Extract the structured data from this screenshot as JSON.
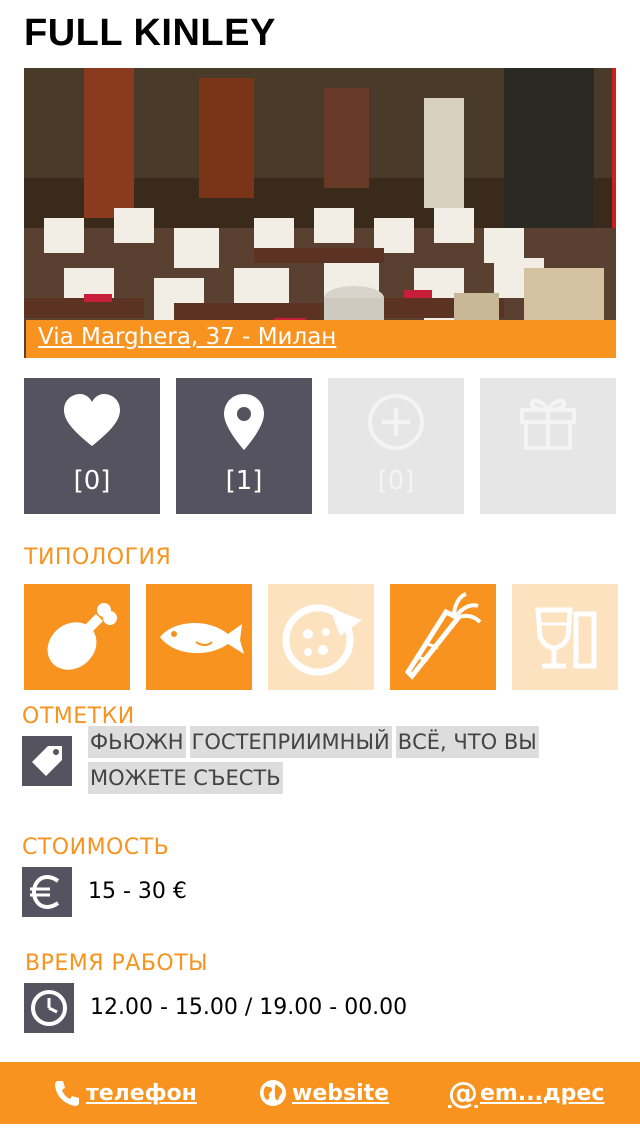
{
  "venue": {
    "name": "FULL KINLEY",
    "address": "Via Marghera, 37  - Милан"
  },
  "actions": [
    {
      "icon": "heart-icon",
      "count": "[0]",
      "enabled": true
    },
    {
      "icon": "map-pin-icon",
      "count": "[1]",
      "enabled": true
    },
    {
      "icon": "plus-circle-icon",
      "count": "[0]",
      "enabled": false
    },
    {
      "icon": "gift-icon",
      "count": "",
      "enabled": false
    }
  ],
  "typology": {
    "label": "ТИПОЛОГИЯ",
    "items": [
      {
        "icon": "meat-drumstick-icon",
        "active": true
      },
      {
        "icon": "fish-icon",
        "active": true
      },
      {
        "icon": "pizza-icon",
        "active": false
      },
      {
        "icon": "carrot-icon",
        "active": true
      },
      {
        "icon": "drinks-icon",
        "active": false
      }
    ]
  },
  "tags": {
    "label": "ОТМЕТКИ",
    "icon": "tag-icon",
    "items": [
      "ФЬЮЖН",
      "ГОСТЕПРИИМНЫЙ",
      "ВСЁ, ЧТО ВЫ",
      "МОЖЕТЕ СЪЕСТЬ"
    ]
  },
  "price": {
    "label": "СТОИМОСТЬ",
    "icon": "euro-icon",
    "value": "15 - 30 €"
  },
  "hours": {
    "label": "ВРЕМЯ РАБОТЫ",
    "icon": "clock-icon",
    "value": "12.00 - 15.00 / 19.00 - 00.00"
  },
  "footer": {
    "phone": "телефон",
    "website": "website",
    "email": "em...дрес"
  },
  "colors": {
    "accent": "#f7931e",
    "accent_faded": "#fde2c0",
    "dark_tile": "#555360",
    "disabled_tile": "#e6e6e6"
  }
}
